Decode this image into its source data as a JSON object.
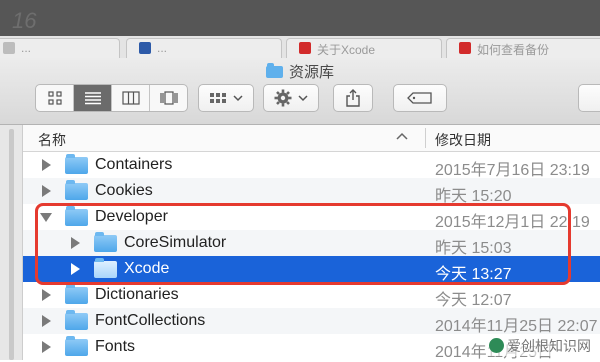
{
  "window": {
    "title": "资源库"
  },
  "top_bar": {
    "mark": "16"
  },
  "browser_tabs": [
    {
      "label": "...",
      "fav_color": "#9a9a9a"
    },
    {
      "label": "...",
      "fav_color": "#2d5aa8"
    },
    {
      "label": "关于Xcode",
      "fav_color": "#d22b2b"
    },
    {
      "label": "如何查看备份",
      "fav_color": "#d22b2b"
    }
  ],
  "toolbar": {
    "view_modes": [
      "icon-view-icon",
      "list-view-icon",
      "column-view-icon",
      "cover-flow-icon"
    ],
    "arrange_icon": "grid-menu-icon",
    "action_icon": "gear-icon",
    "share_icon": "share-icon",
    "tag_icon": "tag-icon"
  },
  "columns": {
    "name": "名称",
    "date": "修改日期",
    "sort_indicator": "^"
  },
  "rows": [
    {
      "name": "Containers",
      "date": "2015年7月16日 23:19",
      "level": 0,
      "expanded": false,
      "selected": false
    },
    {
      "name": "Cookies",
      "date": "昨天 15:20",
      "level": 0,
      "expanded": false,
      "selected": false
    },
    {
      "name": "Developer",
      "date": "2015年12月1日 22:19",
      "level": 0,
      "expanded": true,
      "selected": false
    },
    {
      "name": "CoreSimulator",
      "date": "昨天 15:03",
      "level": 1,
      "expanded": false,
      "selected": false
    },
    {
      "name": "Xcode",
      "date": "今天 13:27",
      "level": 1,
      "expanded": false,
      "selected": true
    },
    {
      "name": "Dictionaries",
      "date": "今天 12:07",
      "level": 0,
      "expanded": false,
      "selected": false
    },
    {
      "name": "FontCollections",
      "date": "2014年11月25日 22:07",
      "level": 0,
      "expanded": false,
      "selected": false
    },
    {
      "name": "Fonts",
      "date": "2014年11月25日",
      "level": 0,
      "expanded": false,
      "selected": false
    }
  ],
  "colors": {
    "selection": "#1a63d9",
    "highlight_box": "#e53a2f",
    "folder": "#5fb0ec"
  },
  "watermark": {
    "text": "爱创根知识网"
  }
}
